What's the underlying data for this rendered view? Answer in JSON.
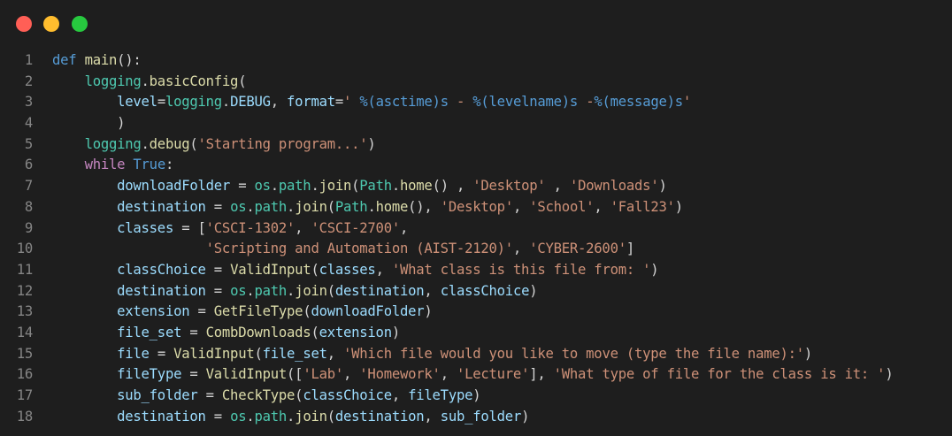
{
  "colors": {
    "background": "#1e1e1e",
    "close": "#ff5f56",
    "minimize": "#ffbd2e",
    "zoom": "#27c93f",
    "line_number": "#858585",
    "keyword": "#569cd6",
    "control": "#c586c0",
    "function": "#dcdcaa",
    "string": "#ce9178",
    "variable": "#9cdcfe",
    "class": "#4ec9b0",
    "plain": "#d4d4d4"
  },
  "window_controls": [
    "close-icon",
    "minimize-icon",
    "zoom-icon"
  ],
  "lines": [
    {
      "n": "1",
      "tokens": [
        [
          "kw",
          "def"
        ],
        [
          "pl",
          " "
        ],
        [
          "fn",
          "main"
        ],
        [
          "pl",
          "():"
        ]
      ]
    },
    {
      "n": "2",
      "tokens": [
        [
          "pl",
          "    "
        ],
        [
          "cls",
          "logging"
        ],
        [
          "pl",
          "."
        ],
        [
          "fn",
          "basicConfig"
        ],
        [
          "pl",
          "("
        ]
      ]
    },
    {
      "n": "3",
      "tokens": [
        [
          "pl",
          "        "
        ],
        [
          "var",
          "level"
        ],
        [
          "op",
          "="
        ],
        [
          "cls",
          "logging"
        ],
        [
          "pl",
          "."
        ],
        [
          "var",
          "DEBUG"
        ],
        [
          "pl",
          ", "
        ],
        [
          "var",
          "format"
        ],
        [
          "op",
          "="
        ],
        [
          "str",
          "' "
        ],
        [
          "fmt",
          "%(asctime)s"
        ],
        [
          "str",
          " - "
        ],
        [
          "fmt",
          "%(levelname)s"
        ],
        [
          "str",
          " -"
        ],
        [
          "fmt",
          "%(message)s"
        ],
        [
          "str",
          "'"
        ]
      ]
    },
    {
      "n": "4",
      "tokens": [
        [
          "pl",
          "        )"
        ]
      ]
    },
    {
      "n": "5",
      "tokens": [
        [
          "pl",
          "    "
        ],
        [
          "cls",
          "logging"
        ],
        [
          "pl",
          "."
        ],
        [
          "fn",
          "debug"
        ],
        [
          "pl",
          "("
        ],
        [
          "str",
          "'Starting program...'"
        ],
        [
          "pl",
          ")"
        ]
      ]
    },
    {
      "n": "6",
      "tokens": [
        [
          "pl",
          "    "
        ],
        [
          "ctl",
          "while"
        ],
        [
          "pl",
          " "
        ],
        [
          "kw",
          "True"
        ],
        [
          "pl",
          ":"
        ]
      ]
    },
    {
      "n": "7",
      "tokens": [
        [
          "pl",
          "        "
        ],
        [
          "var",
          "downloadFolder"
        ],
        [
          "pl",
          " "
        ],
        [
          "op",
          "="
        ],
        [
          "pl",
          " "
        ],
        [
          "cls",
          "os"
        ],
        [
          "pl",
          "."
        ],
        [
          "cls",
          "path"
        ],
        [
          "pl",
          "."
        ],
        [
          "fn",
          "join"
        ],
        [
          "pl",
          "("
        ],
        [
          "cls",
          "Path"
        ],
        [
          "pl",
          "."
        ],
        [
          "fn",
          "home"
        ],
        [
          "pl",
          "() , "
        ],
        [
          "str",
          "'Desktop'"
        ],
        [
          "pl",
          " , "
        ],
        [
          "str",
          "'Downloads'"
        ],
        [
          "pl",
          ")"
        ]
      ]
    },
    {
      "n": "8",
      "tokens": [
        [
          "pl",
          "        "
        ],
        [
          "var",
          "destination"
        ],
        [
          "pl",
          " "
        ],
        [
          "op",
          "="
        ],
        [
          "pl",
          " "
        ],
        [
          "cls",
          "os"
        ],
        [
          "pl",
          "."
        ],
        [
          "cls",
          "path"
        ],
        [
          "pl",
          "."
        ],
        [
          "fn",
          "join"
        ],
        [
          "pl",
          "("
        ],
        [
          "cls",
          "Path"
        ],
        [
          "pl",
          "."
        ],
        [
          "fn",
          "home"
        ],
        [
          "pl",
          "(), "
        ],
        [
          "str",
          "'Desktop'"
        ],
        [
          "pl",
          ", "
        ],
        [
          "str",
          "'School'"
        ],
        [
          "pl",
          ", "
        ],
        [
          "str",
          "'Fall23'"
        ],
        [
          "pl",
          ")"
        ]
      ]
    },
    {
      "n": "9",
      "tokens": [
        [
          "pl",
          "        "
        ],
        [
          "var",
          "classes"
        ],
        [
          "pl",
          " "
        ],
        [
          "op",
          "="
        ],
        [
          "pl",
          " ["
        ],
        [
          "str",
          "'CSCI-1302'"
        ],
        [
          "pl",
          ", "
        ],
        [
          "str",
          "'CSCI-2700'"
        ],
        [
          "pl",
          ","
        ]
      ]
    },
    {
      "n": "10",
      "tokens": [
        [
          "pl",
          "                   "
        ],
        [
          "str",
          "'Scripting and Automation (AIST-2120)'"
        ],
        [
          "pl",
          ", "
        ],
        [
          "str",
          "'CYBER-2600'"
        ],
        [
          "pl",
          "]"
        ]
      ]
    },
    {
      "n": "11",
      "tokens": [
        [
          "pl",
          "        "
        ],
        [
          "var",
          "classChoice"
        ],
        [
          "pl",
          " "
        ],
        [
          "op",
          "="
        ],
        [
          "pl",
          " "
        ],
        [
          "fn",
          "ValidInput"
        ],
        [
          "pl",
          "("
        ],
        [
          "var",
          "classes"
        ],
        [
          "pl",
          ", "
        ],
        [
          "str",
          "'What class is this file from: '"
        ],
        [
          "pl",
          ")"
        ]
      ]
    },
    {
      "n": "12",
      "tokens": [
        [
          "pl",
          "        "
        ],
        [
          "var",
          "destination"
        ],
        [
          "pl",
          " "
        ],
        [
          "op",
          "="
        ],
        [
          "pl",
          " "
        ],
        [
          "cls",
          "os"
        ],
        [
          "pl",
          "."
        ],
        [
          "cls",
          "path"
        ],
        [
          "pl",
          "."
        ],
        [
          "fn",
          "join"
        ],
        [
          "pl",
          "("
        ],
        [
          "var",
          "destination"
        ],
        [
          "pl",
          ", "
        ],
        [
          "var",
          "classChoice"
        ],
        [
          "pl",
          ")"
        ]
      ]
    },
    {
      "n": "13",
      "tokens": [
        [
          "pl",
          "        "
        ],
        [
          "var",
          "extension"
        ],
        [
          "pl",
          " "
        ],
        [
          "op",
          "="
        ],
        [
          "pl",
          " "
        ],
        [
          "fn",
          "GetFileType"
        ],
        [
          "pl",
          "("
        ],
        [
          "var",
          "downloadFolder"
        ],
        [
          "pl",
          ")"
        ]
      ]
    },
    {
      "n": "14",
      "tokens": [
        [
          "pl",
          "        "
        ],
        [
          "var",
          "file_set"
        ],
        [
          "pl",
          " "
        ],
        [
          "op",
          "="
        ],
        [
          "pl",
          " "
        ],
        [
          "fn",
          "CombDownloads"
        ],
        [
          "pl",
          "("
        ],
        [
          "var",
          "extension"
        ],
        [
          "pl",
          ")"
        ]
      ]
    },
    {
      "n": "15",
      "tokens": [
        [
          "pl",
          "        "
        ],
        [
          "var",
          "file"
        ],
        [
          "pl",
          " "
        ],
        [
          "op",
          "="
        ],
        [
          "pl",
          " "
        ],
        [
          "fn",
          "ValidInput"
        ],
        [
          "pl",
          "("
        ],
        [
          "var",
          "file_set"
        ],
        [
          "pl",
          ", "
        ],
        [
          "str",
          "'Which file would you like to move (type the file name):'"
        ],
        [
          "pl",
          ")"
        ]
      ]
    },
    {
      "n": "16",
      "tokens": [
        [
          "pl",
          "        "
        ],
        [
          "var",
          "fileType"
        ],
        [
          "pl",
          " "
        ],
        [
          "op",
          "="
        ],
        [
          "pl",
          " "
        ],
        [
          "fn",
          "ValidInput"
        ],
        [
          "pl",
          "(["
        ],
        [
          "str",
          "'Lab'"
        ],
        [
          "pl",
          ", "
        ],
        [
          "str",
          "'Homework'"
        ],
        [
          "pl",
          ", "
        ],
        [
          "str",
          "'Lecture'"
        ],
        [
          "pl",
          "], "
        ],
        [
          "str",
          "'What type of file for the class is it: '"
        ],
        [
          "pl",
          ")"
        ]
      ]
    },
    {
      "n": "17",
      "tokens": [
        [
          "pl",
          "        "
        ],
        [
          "var",
          "sub_folder"
        ],
        [
          "pl",
          " "
        ],
        [
          "op",
          "="
        ],
        [
          "pl",
          " "
        ],
        [
          "fn",
          "CheckType"
        ],
        [
          "pl",
          "("
        ],
        [
          "var",
          "classChoice"
        ],
        [
          "pl",
          ", "
        ],
        [
          "var",
          "fileType"
        ],
        [
          "pl",
          ")"
        ]
      ]
    },
    {
      "n": "18",
      "tokens": [
        [
          "pl",
          "        "
        ],
        [
          "var",
          "destination"
        ],
        [
          "pl",
          " "
        ],
        [
          "op",
          "="
        ],
        [
          "pl",
          " "
        ],
        [
          "cls",
          "os"
        ],
        [
          "pl",
          "."
        ],
        [
          "cls",
          "path"
        ],
        [
          "pl",
          "."
        ],
        [
          "fn",
          "join"
        ],
        [
          "pl",
          "("
        ],
        [
          "var",
          "destination"
        ],
        [
          "pl",
          ", "
        ],
        [
          "var",
          "sub_folder"
        ],
        [
          "pl",
          ")"
        ]
      ]
    }
  ]
}
